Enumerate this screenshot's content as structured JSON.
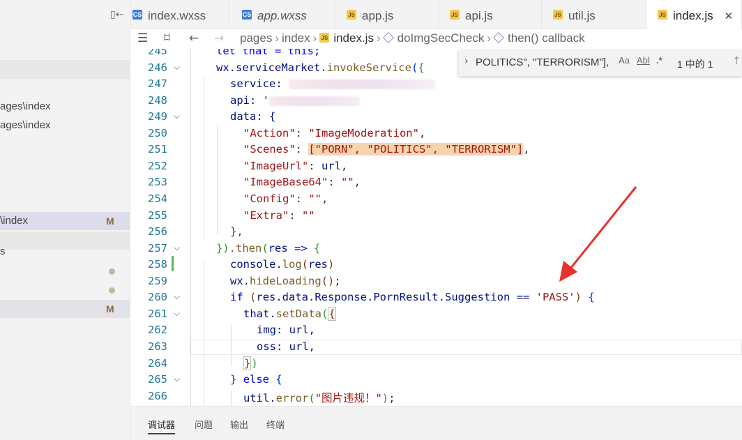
{
  "sidebar": {
    "rows": [
      {
        "text": "ages\\index",
        "badge": ""
      },
      {
        "text": "ages\\index",
        "badge": ""
      },
      {
        "text": "\\index",
        "badge": "M"
      },
      {
        "text": "s",
        "badge": ""
      },
      {
        "text": "",
        "badge": "M"
      }
    ],
    "icons": {
      "split": "split-editor-icon"
    }
  },
  "tabs": [
    {
      "label": "index.wxss",
      "icon": "css-file-icon"
    },
    {
      "label": "app.wxss",
      "icon": "css-file-icon"
    },
    {
      "label": "app.js",
      "icon": "js-file-icon"
    },
    {
      "label": "api.js",
      "icon": "js-file-icon"
    },
    {
      "label": "util.js",
      "icon": "js-file-icon"
    },
    {
      "label": "index.js",
      "icon": "js-file-icon",
      "active": true
    }
  ],
  "breadcrumb": {
    "items": [
      "pages",
      "index",
      "index.js",
      "doImgSecCheck",
      "then() callback"
    ]
  },
  "find": {
    "query": "POLITICS\", \"TERRORISM\"],",
    "match_case": "Aa",
    "whole_word": "Abl",
    "regex": ".*",
    "count": "1 中的 1"
  },
  "editor": {
    "line_numbers": [
      "245",
      "246",
      "247",
      "248",
      "249",
      "250",
      "251",
      "252",
      "253",
      "254",
      "255",
      "256",
      "257",
      "258",
      "259",
      "260",
      "261",
      "262",
      "263",
      "264",
      "265",
      "266"
    ],
    "lines": {
      "l245": "let that = this;",
      "l246_obj": "wx.serviceMarket.",
      "l246_fn": "invokeService",
      "l247_key": "service: ",
      "l248_key": "api: '",
      "l249": "data: {",
      "l250_key": "\"Action\"",
      "l250_val": "\"ImageModeration\"",
      "l251_key": "\"Scenes\"",
      "l251_val": "[\"PORN\", \"POLITICS\", \"TERRORISM\"]",
      "l252_key": "\"ImageUrl\"",
      "l252_val": "url",
      "l253_key": "\"ImageBase64\"",
      "l253_val": "\"\"",
      "l254_key": "\"Config\"",
      "l254_val": "\"\"",
      "l255_key": "\"Extra\"",
      "l255_val": "\"\"",
      "l256": "},",
      "l257_then": ".then",
      "l257_arg": "res",
      "l258_obj": "console.",
      "l258_fn": "log",
      "l258_arg": "res",
      "l259_obj": "wx.",
      "l259_fn": "hideLoading",
      "l260_if": "if",
      "l260_expr": "res.data.Response.PornResult.Suggestion == ",
      "l260_str": "'PASS'",
      "l261_obj": "that.",
      "l261_fn": "setData",
      "l262": "img: url,",
      "l263": "oss: url,",
      "l265_else": "else",
      "l266_obj": "util.",
      "l266_fn": "error",
      "l266_str": "\"图片违规！\""
    }
  },
  "panel": {
    "tabs": [
      "调试器",
      "问题",
      "输出",
      "终端"
    ]
  },
  "annotation": {
    "arrow_color": "#e8312a"
  }
}
